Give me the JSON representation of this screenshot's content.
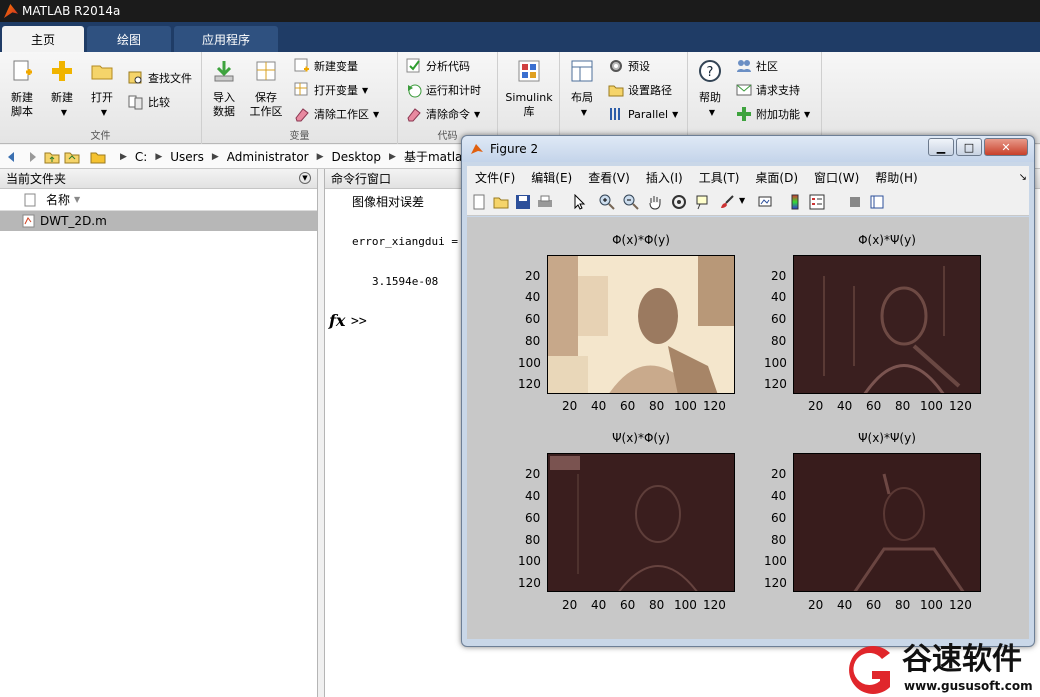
{
  "window": {
    "title": "MATLAB R2014a"
  },
  "tabs": [
    {
      "label": "主页"
    },
    {
      "label": "绘图"
    },
    {
      "label": "应用程序"
    }
  ],
  "ribbon": {
    "file": {
      "label": "文件",
      "new_script": "新建\n脚本",
      "new": "新建",
      "open": "打开",
      "find_files": "查找文件",
      "compare": "比较"
    },
    "variable": {
      "label": "变量",
      "import": "导入\n数据",
      "save_ws": "保存\n工作区",
      "new_var": "新建变量",
      "open_var": "打开变量",
      "clear_ws": "清除工作区"
    },
    "code": {
      "label": "代码",
      "analyze": "分析代码",
      "run_time": "运行和计时",
      "clear_cmd": "清除命令"
    },
    "simulink": {
      "label": "Simulink\n库"
    },
    "environment": {
      "layout": "布局",
      "prefs": "预设",
      "set_path": "设置路径",
      "parallel": "Parallel"
    },
    "resources": {
      "help": "帮助",
      "community": "社区",
      "support": "请求支持",
      "addons": "附加功能"
    }
  },
  "path": {
    "segments": [
      "C:",
      "Users",
      "Administrator",
      "Desktop",
      "基于matlab"
    ]
  },
  "current_folder": {
    "title": "当前文件夹",
    "column": "名称",
    "files": [
      "DWT_2D.m"
    ]
  },
  "command_window": {
    "title": "命令行窗口",
    "line1": "图像相对误差",
    "line2": "error_xiangdui =",
    "line3": "3.1594e-08",
    "fx": "fx",
    "prompt": ">>"
  },
  "figure": {
    "title": "Figure 2",
    "menu": [
      "文件(F)",
      "编辑(E)",
      "查看(V)",
      "插入(I)",
      "工具(T)",
      "桌面(D)",
      "窗口(W)",
      "帮助(H)"
    ],
    "plots": [
      {
        "title": "Φ(x)*Φ(y)"
      },
      {
        "title": "Φ(x)*Ψ(y)"
      },
      {
        "title": "Ψ(x)*Φ(y)"
      },
      {
        "title": "Ψ(x)*Ψ(y)"
      }
    ],
    "yticks": [
      "20",
      "40",
      "60",
      "80",
      "100",
      "120"
    ],
    "xticks": [
      "20",
      "40",
      "60",
      "80",
      "100",
      "120"
    ]
  },
  "watermark": {
    "brand": "谷速软件",
    "url": "www.gususoft.com"
  },
  "colors": {
    "tab_bg": "#1f3c66",
    "selection": "#b7b7b7",
    "brand_red": "#e0262b"
  }
}
